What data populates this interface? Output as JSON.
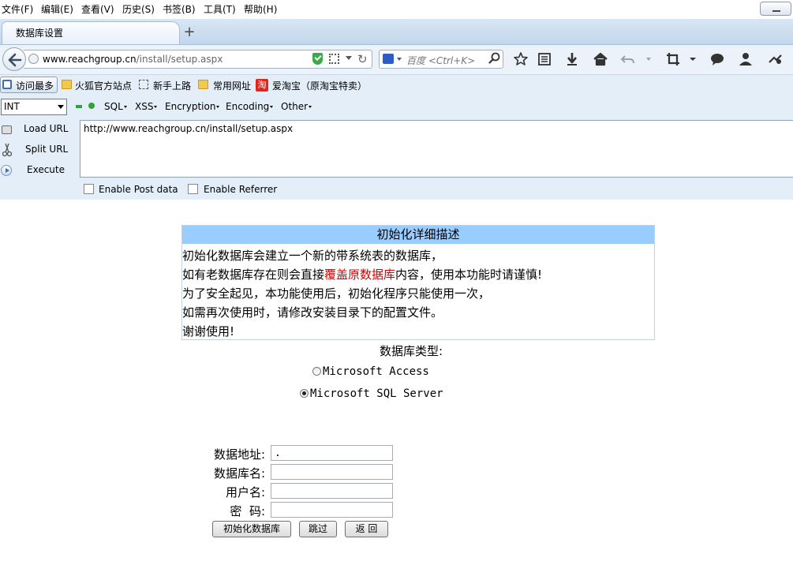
{
  "menubar": {
    "items": [
      "文件(F)",
      "编辑(E)",
      "查看(V)",
      "历史(S)",
      "书签(B)",
      "工具(T)",
      "帮助(H)"
    ]
  },
  "tab": {
    "title": "数据库设置",
    "new_tab": "+"
  },
  "navbar": {
    "url_host": "www.reachgroup.cn",
    "url_path": "/install/setup.aspx",
    "search_placeholder": "百度 <Ctrl+K>"
  },
  "bookmarks": {
    "items": [
      "访问最多",
      "火狐官方站点",
      "新手上路",
      "常用网址",
      "爱淘宝（原淘宝特卖）"
    ],
    "tao_glyph": "淘"
  },
  "hackbar": {
    "select_value": "INT",
    "menus": [
      "SQL",
      "XSS",
      "Encryption",
      "Encoding",
      "Other"
    ],
    "actions": [
      "Load URL",
      "Split URL",
      "Execute"
    ],
    "url_value": "http://www.reachgroup.cn/install/setup.aspx",
    "checkboxes": [
      "Enable Post data",
      "Enable Referrer"
    ]
  },
  "content": {
    "desc_title": "初始化详细描述",
    "desc_line1": "初始化数据库会建立一个新的带系统表的数据库，",
    "desc_line2_before": "如有老数据库存在则会直接",
    "desc_line2_red": "覆盖原数据库",
    "desc_line2_after": "内容，使用本功能时请谨慎!",
    "desc_line3": "为了安全起见，本功能使用后，初始化程序只能使用一次，",
    "desc_line4": "如需再次使用时，请修改安装目录下的配置文件。",
    "desc_line5": "谢谢使用!",
    "db_type_label": "数据库类型:",
    "db_options": [
      "Microsoft Access",
      "Microsoft SQL Server"
    ],
    "db_selected": "Microsoft SQL Server",
    "form": {
      "server_label": "数据地址:",
      "server_value": ".",
      "dbname_label": "数据库名:",
      "dbname_value": "",
      "user_label": "用户名:",
      "user_value": "",
      "pass_label": "密  码:",
      "pass_value": ""
    },
    "buttons": {
      "init": "初始化数据库",
      "skip": "跳过",
      "back": "返 回"
    }
  },
  "colors": {
    "desc_header_bg": "#99ccff",
    "warning_red": "#d40000",
    "chrome_bg": "#e4eef9"
  }
}
